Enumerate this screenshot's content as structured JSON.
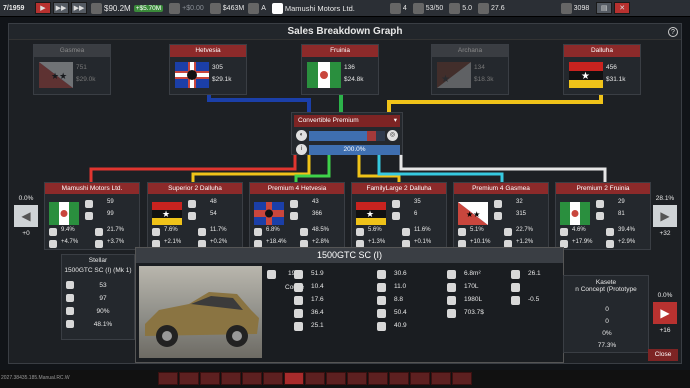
{
  "topbar": {
    "date": "7/1959",
    "cash": "$90.2M",
    "cash_delta": "+$5.70M",
    "loan": "+$0.00",
    "value": "$463M",
    "grade": "A",
    "company": "Mamushi Motors Ltd.",
    "count_a": "4",
    "capacity": "53/50",
    "rating": "5.0",
    "temp": "27.6",
    "research": "3098"
  },
  "panel": {
    "title": "Sales Breakdown Graph",
    "help": "?"
  },
  "countries": [
    {
      "name": "Gasmea",
      "v1": "751",
      "v2": "$29.0k",
      "state": "dim"
    },
    {
      "name": "Hetvesia",
      "v1": "305",
      "v2": "$29.1k",
      "state": "active"
    },
    {
      "name": "Fruinia",
      "v1": "136",
      "v2": "$24.8k",
      "state": "active"
    },
    {
      "name": "Archana",
      "v1": "134",
      "v2": "$18.3k",
      "state": "dim"
    },
    {
      "name": "Dalluha",
      "v1": "456",
      "v2": "$31.1k",
      "state": "active"
    }
  ],
  "selector": {
    "label": "Convertible Premium",
    "pct": "200.0%",
    "bar_fill": 0.76,
    "bar_red": 0.12
  },
  "competitors": [
    {
      "name": "Mamushi Motors Ltd.",
      "a": "59",
      "b": "99",
      "c": "9.4%",
      "d": "21.7%",
      "e": "+4.7%",
      "f": "+3.7%",
      "line": "#e0352f"
    },
    {
      "name": "Superior 2 Dalluha",
      "a": "48",
      "b": "54",
      "c": "7.6%",
      "d": "11.7%",
      "e": "+2.1%",
      "f": "+0.2%",
      "line": "#f0c319"
    },
    {
      "name": "Premium 4 Hetvesia",
      "a": "43",
      "b": "366",
      "c": "6.8%",
      "d": "48.5%",
      "e": "+18.4%",
      "f": "+2.8%",
      "line": "#3fd24a"
    },
    {
      "name": "FamilyLarge 2 Dalluha",
      "a": "35",
      "b": "6",
      "c": "5.6%",
      "d": "11.6%",
      "e": "+1.3%",
      "f": "+0.1%",
      "line": "#f0c319"
    },
    {
      "name": "Premium 4 Gasmea",
      "a": "32",
      "b": "315",
      "c": "5.1%",
      "d": "22.7%",
      "e": "+10.1%",
      "f": "+1.2%",
      "line": "#36c9e0"
    },
    {
      "name": "Premium 2 Fruinia",
      "a": "29",
      "b": "81",
      "c": "4.6%",
      "d": "39.4%",
      "e": "+17.9%",
      "f": "+2.9%",
      "line": "#e6e6e6"
    }
  ],
  "side_left": {
    "top": "0.0%",
    "bottom": "+0"
  },
  "side_right": {
    "top": "28.1%",
    "bottom": "+32"
  },
  "side_right2": {
    "top": "0.0%",
    "bottom": "+16"
  },
  "stellar": {
    "title": "Stellar",
    "sub": "1500GTC SC (I) (Mk 1)",
    "r1": "53",
    "r2": "97",
    "r3": "90%",
    "r4": "48.1%"
  },
  "popup": {
    "title": "1500GTC SC (I)",
    "year": "1957",
    "body": "Coupe",
    "stats_a": [
      "51.9",
      "10.4",
      "17.6",
      "36.4",
      "25.1"
    ],
    "stats_b": [
      "30.6",
      "11.0",
      "8.8",
      "50.4",
      "40.9"
    ],
    "stats_c": [
      "6.8m²",
      "170L",
      "1980L",
      "703.7$"
    ],
    "stats_d": [
      "26.1",
      "",
      "-0.5"
    ]
  },
  "kasete": {
    "title": "Kasete",
    "sub": "n Concept (Prototype",
    "r1": "0",
    "r2": "0",
    "r3": "0%",
    "r4": "77.3%"
  },
  "close_label": "Close",
  "version": "2027.38435.185.Manual.RC.W",
  "colors": {
    "accent": "#8c2a2a",
    "panel": "#1d2024"
  }
}
